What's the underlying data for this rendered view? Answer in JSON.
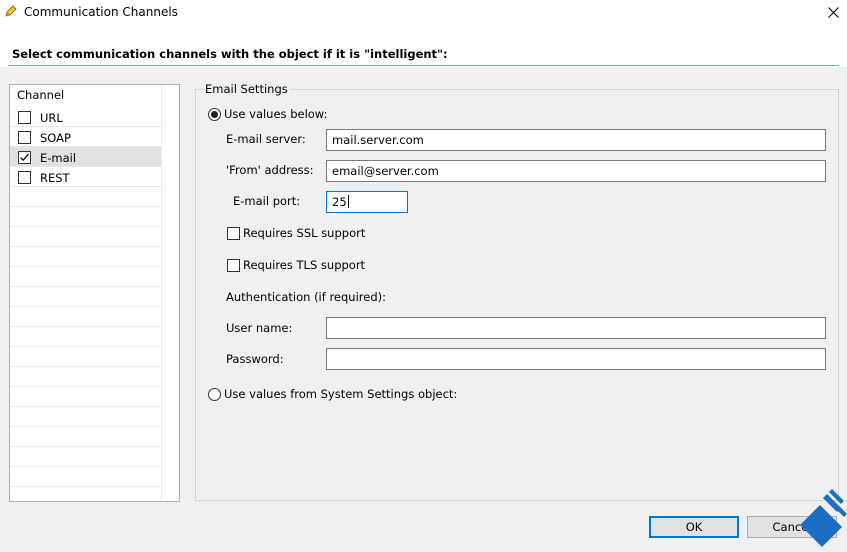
{
  "window": {
    "title": "Communication Channels"
  },
  "heading": "Select communication channels with the object if it is \"intelligent\":",
  "channel_list": {
    "header": "Channel",
    "items": [
      {
        "label": "URL",
        "checked": false
      },
      {
        "label": "SOAP",
        "checked": false
      },
      {
        "label": "E-mail",
        "checked": true,
        "selected": true
      },
      {
        "label": "REST",
        "checked": false
      }
    ]
  },
  "email_settings": {
    "title": "Email Settings",
    "use_values_below": "Use values below:",
    "email_server_label": "E-mail server:",
    "email_server_value": "mail.server.com",
    "from_address_label": "'From' address:",
    "from_address_value": "email@server.com",
    "email_port_label": "E-mail port:",
    "email_port_value": "25",
    "ssl_label": "Requires SSL support",
    "tls_label": "Requires TLS support",
    "auth_label": "Authentication (if required):",
    "username_label": "User name:",
    "username_value": "",
    "password_label": "Password:",
    "password_value": "",
    "use_system_settings": "Use values from System Settings object:"
  },
  "buttons": {
    "ok": "OK",
    "cancel": "Cancel"
  },
  "colors": {
    "accent": "#0078d7",
    "logo": "#1b6ec2"
  }
}
